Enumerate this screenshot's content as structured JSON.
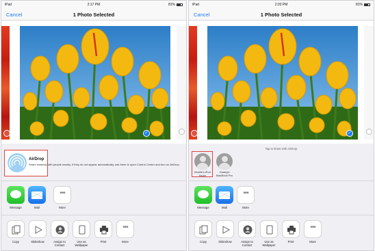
{
  "panels": [
    {
      "status": {
        "device": "iPad",
        "time": "2:17 PM",
        "battery": "81%"
      },
      "nav": {
        "cancel": "Cancel",
        "title": "1 Photo Selected"
      },
      "airdrop": {
        "title": "AirDrop",
        "description": "Share instantly with people nearby. If they do not appear automatically, ask them to open Control Center and turn on AirDrop."
      },
      "apps": [
        "Message",
        "Mail",
        "More"
      ],
      "actions": [
        "Copy",
        "Slideshow",
        "Assign to Contact",
        "Use as Wallpaper",
        "Print",
        "More"
      ]
    },
    {
      "status": {
        "device": "iPad",
        "time": "2:20 PM",
        "battery": "81%"
      },
      "nav": {
        "cancel": "Cancel",
        "title": "1 Photo Selected"
      },
      "airdrop": {
        "tap_note": "Tap to share with AirDrop",
        "devices": [
          "Mobile's iPod touch",
          "Guang's MacBook Pro"
        ]
      },
      "apps": [
        "Message",
        "Mail",
        "More"
      ],
      "actions": [
        "Copy",
        "Slideshow",
        "Assign to Contact",
        "Use as Wallpaper",
        "Print",
        "More"
      ]
    }
  ],
  "colors": {
    "accent": "#1a7cf5",
    "highlight": "#dd4444"
  },
  "icons": {
    "apps": [
      "message-icon",
      "mail-icon",
      "more-icon"
    ],
    "actions": [
      "copy-icon",
      "slideshow-icon",
      "assign-contact-icon",
      "wallpaper-icon",
      "print-icon",
      "more-icon"
    ]
  }
}
